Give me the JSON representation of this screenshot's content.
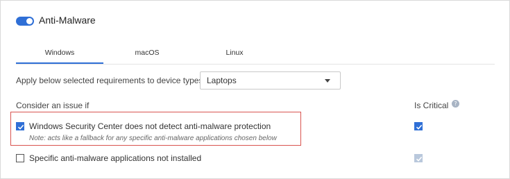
{
  "header": {
    "title": "Anti-Malware",
    "toggle_on": true
  },
  "tabs": [
    {
      "label": "Windows",
      "active": true
    },
    {
      "label": "macOS",
      "active": false
    },
    {
      "label": "Linux",
      "active": false
    }
  ],
  "device_type": {
    "label": "Apply below selected requirements to device types:",
    "selected": "Laptops"
  },
  "conditions": {
    "header": "Consider an issue if",
    "critical_header": "Is Critical",
    "items": [
      {
        "label": "Windows Security Center does not detect anti-malware protection",
        "note": "Note: acts like a fallback for any specific anti-malware applications chosen below",
        "checked": true,
        "critical": true,
        "highlighted": true
      },
      {
        "label": "Specific anti-malware applications not installed",
        "checked": false,
        "critical": true,
        "critical_disabled": true
      }
    ]
  },
  "colors": {
    "accent": "#2f6fd6",
    "highlight": "#d9534f",
    "disabled_check": "#b9c8dc"
  }
}
